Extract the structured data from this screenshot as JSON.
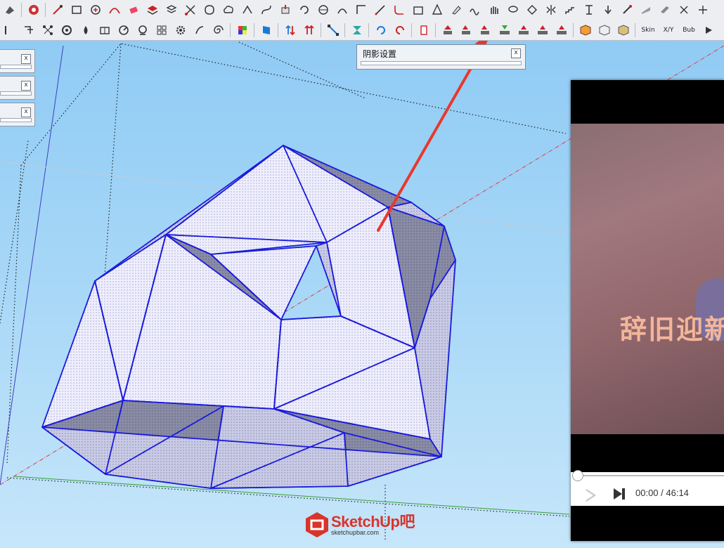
{
  "panels": {
    "shadow_settings": {
      "title": "阴影设置",
      "close_glyph": "x"
    },
    "trays": [
      {
        "close_glyph": "x"
      },
      {
        "close_glyph": "x"
      },
      {
        "close_glyph": "x"
      }
    ]
  },
  "toolbar2": {
    "skin_label": "Skin",
    "xy_label": "X/Y",
    "bub_label": "Bub"
  },
  "video": {
    "caption": "辞旧迎新",
    "time": "00:00 / 46:14"
  },
  "logo": {
    "name": "SketchUp吧",
    "url": "sketchupbar.com"
  },
  "colors": {
    "sky": "#8cc9f4",
    "edge": "#1a1adc",
    "face_light": "#eeeefe",
    "face_shade": "#7a7d98",
    "arrow": "#e8382e",
    "axis_red": "#d94040",
    "axis_green": "#36a036",
    "axis_blue": "#3f3fbf"
  }
}
